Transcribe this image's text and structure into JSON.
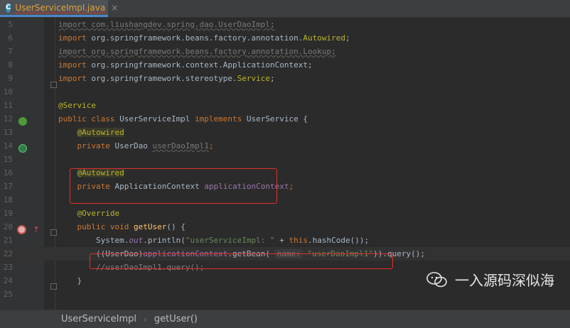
{
  "tab": {
    "label": "UserServiceImpl.java",
    "icon": "C",
    "close": "×"
  },
  "lines": [
    {
      "n": "5",
      "code": [
        [
          "dim",
          "import com.liushangdev.spring.dao.UserDaoImpl;"
        ]
      ]
    },
    {
      "n": "6",
      "code": [
        [
          "kw",
          "import "
        ],
        [
          "",
          "org.springframework.beans.factory.annotation."
        ],
        [
          "ann",
          "Autowired"
        ],
        [
          "",
          ";"
        ]
      ]
    },
    {
      "n": "7",
      "code": [
        [
          "dim",
          "import org.springframework.beans.factory.annotation.Lookup;"
        ]
      ]
    },
    {
      "n": "8",
      "code": [
        [
          "kw",
          "import "
        ],
        [
          "",
          "org.springframework.context.ApplicationContext;"
        ]
      ]
    },
    {
      "n": "9",
      "code": [
        [
          "kw",
          "import "
        ],
        [
          "",
          "org.springframework.stereotype."
        ],
        [
          "ann",
          "Service"
        ],
        [
          "",
          ";"
        ]
      ]
    },
    {
      "n": "10",
      "code": []
    },
    {
      "n": "11",
      "code": [
        [
          "ann",
          "@Service"
        ]
      ]
    },
    {
      "n": "12",
      "code": [
        [
          "kw",
          "public class "
        ],
        [
          "",
          "UserServiceImpl "
        ],
        [
          "kw",
          "implements "
        ],
        [
          "",
          "UserService {"
        ]
      ]
    },
    {
      "n": "13",
      "code": [
        [
          "",
          "    "
        ],
        [
          "ann-hl",
          "@Autowired"
        ]
      ]
    },
    {
      "n": "14",
      "code": [
        [
          "",
          "    "
        ],
        [
          "kw",
          "private "
        ],
        [
          "",
          "UserDao "
        ],
        [
          "dim",
          "userDaoImpl1"
        ],
        [
          "kw",
          ";"
        ]
      ]
    },
    {
      "n": "15",
      "code": []
    },
    {
      "n": "16",
      "code": [
        [
          "",
          "    "
        ],
        [
          "ann-hl",
          "@Autowired"
        ]
      ]
    },
    {
      "n": "17",
      "code": [
        [
          "",
          "    "
        ],
        [
          "kw",
          "private "
        ],
        [
          "",
          "ApplicationContext "
        ],
        [
          "field",
          "applicationContext"
        ],
        [
          "kw",
          ";"
        ]
      ]
    },
    {
      "n": "18",
      "code": []
    },
    {
      "n": "19",
      "code": [
        [
          "",
          "    "
        ],
        [
          "ann",
          "@Override"
        ]
      ]
    },
    {
      "n": "20",
      "code": [
        [
          "",
          "    "
        ],
        [
          "kw",
          "public void "
        ],
        [
          "fn",
          "getUser"
        ],
        [
          "",
          "() {"
        ]
      ]
    },
    {
      "n": "21",
      "code": [
        [
          "",
          "        System."
        ],
        [
          "stat",
          "out"
        ],
        [
          "",
          ".println("
        ],
        [
          "str",
          "\"userServiceImpl: \""
        ],
        [
          "",
          " + "
        ],
        [
          "kw",
          "this"
        ],
        [
          "",
          ".hashCode());"
        ]
      ]
    },
    {
      "n": "22",
      "code": [
        [
          "",
          "        ((UserDao)"
        ],
        [
          "field",
          "applicationContext"
        ],
        [
          "",
          ".getBean( "
        ],
        [
          "hint",
          "name:"
        ],
        [
          "",
          ""
        ],
        [
          "str",
          " \"userDaoImpl1\""
        ],
        [
          "",
          ")).query();"
        ]
      ]
    },
    {
      "n": "23",
      "code": [
        [
          "",
          "        "
        ],
        [
          "cmt",
          "//userDaoImpl1.query();"
        ]
      ]
    },
    {
      "n": "24",
      "code": [
        [
          "",
          "    }"
        ]
      ]
    },
    {
      "n": "25",
      "code": []
    }
  ],
  "watermark": {
    "text": "一入源码深似海"
  },
  "breadcrumb": {
    "class": "UserServiceImpl",
    "method": "getUser()"
  },
  "colors": {
    "keyword": "#cc7832",
    "annotation": "#bbb529",
    "field": "#9876aa",
    "string": "#6a8759",
    "highlight_box": "#e03030"
  }
}
